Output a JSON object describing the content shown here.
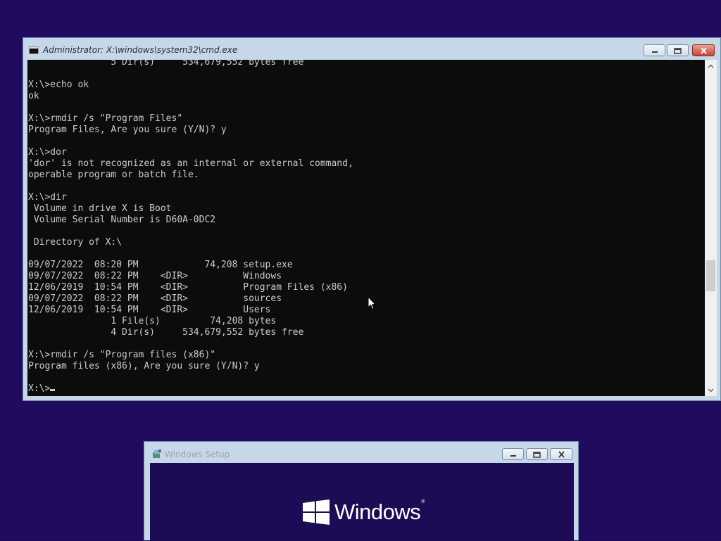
{
  "cmd_window": {
    "title": "Administrator: X:\\windows\\system32\\cmd.exe",
    "console_lines": [
      "               5 Dir(s)     534,679,552 bytes free",
      "",
      "X:\\>echo ok",
      "ok",
      "",
      "X:\\>rmdir /s \"Program Files\"",
      "Program Files, Are you sure (Y/N)? y",
      "",
      "X:\\>dor",
      "'dor' is not recognized as an internal or external command,",
      "operable program or batch file.",
      "",
      "X:\\>dir",
      " Volume in drive X is Boot",
      " Volume Serial Number is D60A-0DC2",
      "",
      " Directory of X:\\",
      "",
      "09/07/2022  08:20 PM            74,208 setup.exe",
      "09/07/2022  08:22 PM    <DIR>          Windows",
      "12/06/2019  10:54 PM    <DIR>          Program Files (x86)",
      "09/07/2022  08:22 PM    <DIR>          sources",
      "12/06/2019  10:54 PM    <DIR>          Users",
      "               1 File(s)         74,208 bytes",
      "               4 Dir(s)     534,679,552 bytes free",
      "",
      "X:\\>rmdir /s \"Program files (x86)\"",
      "Program files (x86), Are you sure (Y/N)? y",
      ""
    ],
    "prompt": "X:\\>",
    "colors": {
      "background": "#0c0c0c",
      "foreground": "#cccccc"
    }
  },
  "setup_window": {
    "title": "Windows Setup",
    "logo_text": "Windows",
    "logo_tm": "®",
    "colors": {
      "background": "#1c0b55",
      "logo": "#ffffff"
    }
  },
  "icons": {
    "cmd": "console-icon",
    "setup": "setup-icon",
    "minimize": "minimize-icon",
    "maximize": "restore-icon",
    "close": "close-icon",
    "scroll_up": "chevron-up-icon",
    "scroll_down": "chevron-down-icon",
    "windows_logo": "windows-logo-icon",
    "pointer": "mouse-pointer-icon"
  },
  "desktop": {
    "background": "#200b5e"
  }
}
